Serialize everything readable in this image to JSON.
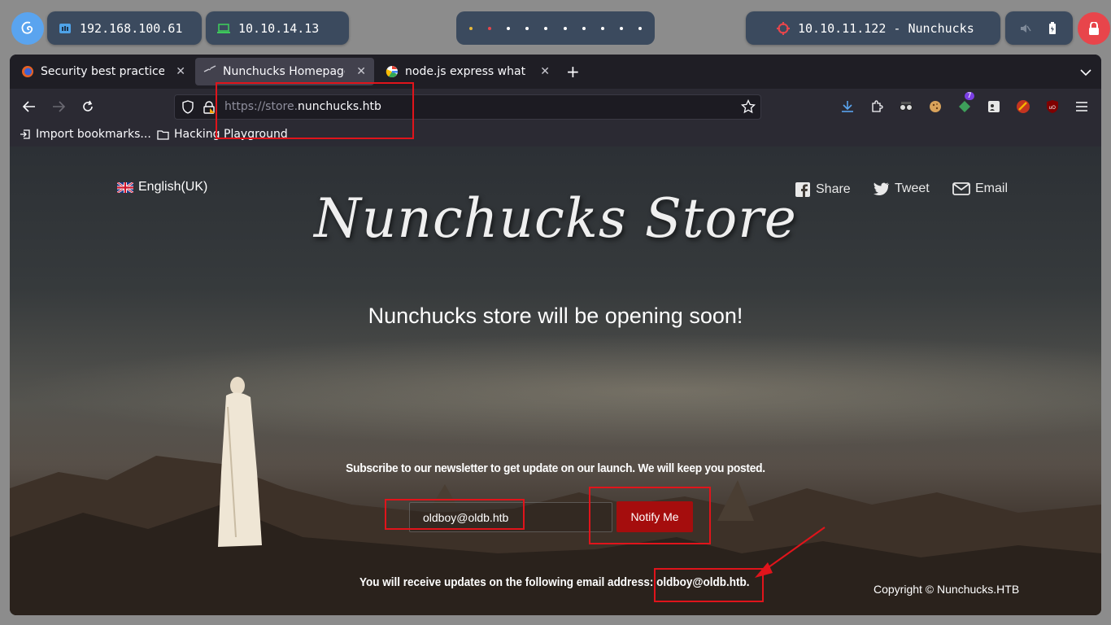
{
  "system_bar": {
    "local_ip": "192.168.100.61",
    "vpn_ip": "10.10.14.13",
    "target": "10.10.11.122 - Nunchucks"
  },
  "browser": {
    "tabs": [
      {
        "title": "Security best practices |",
        "active": false
      },
      {
        "title": "Nunchucks Homepage",
        "active": true
      },
      {
        "title": "node.js express what is i",
        "active": false
      }
    ],
    "url_scheme": "https://store.",
    "url_host": "nunchucks.htb",
    "extension_badge": "7",
    "bookmarks": [
      {
        "label": "Import bookmarks..."
      },
      {
        "label": "Hacking Playground"
      }
    ]
  },
  "page": {
    "language": "English(UK)",
    "social": {
      "share": "Share",
      "tweet": "Tweet",
      "email": "Email"
    },
    "title": "Nunchucks Store",
    "headline": "Nunchucks store will be opening soon!",
    "subscribe_text": "Subscribe to our newsletter to get update on our launch. We will keep you posted.",
    "email_value": "oldboy@oldb.htb",
    "notify_label": "Notify Me",
    "receive_text": "You will receive updates on the following email address: ",
    "receive_email": "oldboy@oldb.htb.",
    "copyright": "Copyright © Nunchucks.HTB"
  },
  "colors": {
    "annotation_red": "#e0141b",
    "notify_button": "#a50d0d",
    "topbar_pill": "#3b4a5e"
  }
}
